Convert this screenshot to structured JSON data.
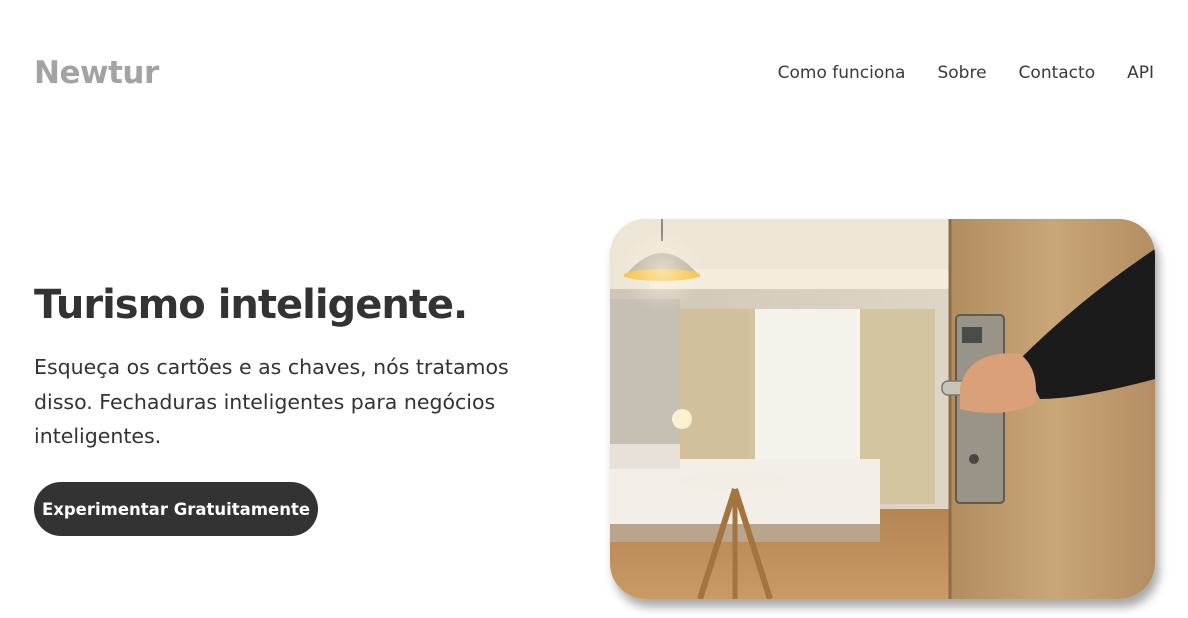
{
  "header": {
    "brand": "Newtur",
    "nav": [
      {
        "label": "Como funciona"
      },
      {
        "label": "Sobre"
      },
      {
        "label": "Contacto"
      },
      {
        "label": "API"
      }
    ]
  },
  "hero": {
    "title": "Turismo inteligente.",
    "text": "Esqueça os cartões e as chaves, nós tratamos disso. Fechaduras inteligentes para negócios inteligentes.",
    "cta_label": "Experimentar Gratuitamente"
  },
  "colors": {
    "brand": "#a3a3a3",
    "text": "#333333",
    "button_bg": "#333333",
    "button_text": "#ffffff"
  }
}
